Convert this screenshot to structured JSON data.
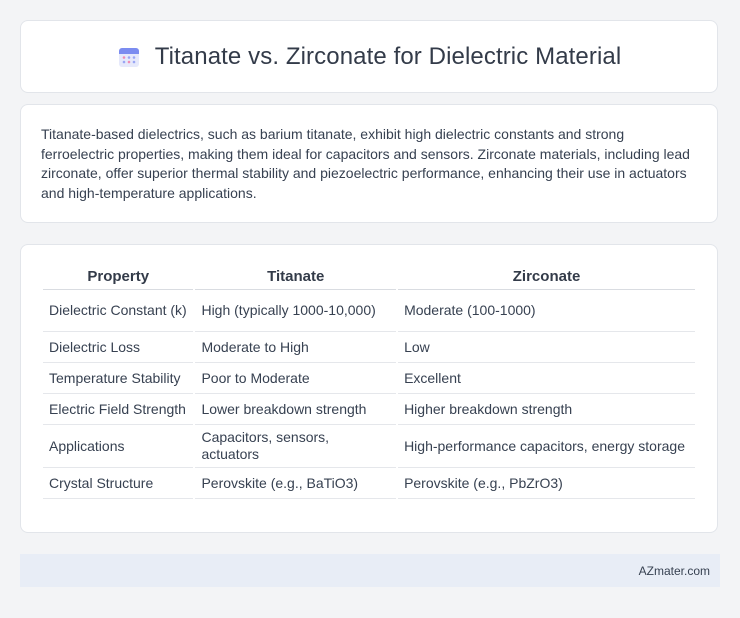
{
  "header": {
    "title": "Titanate vs. Zirconate for Dielectric Material",
    "icon": "calendar-icon"
  },
  "summary": {
    "text": "Titanate-based dielectrics, such as barium titanate, exhibit high dielectric constants and strong ferroelectric properties, making them ideal for capacitors and sensors. Zirconate materials, including lead zirconate, offer superior thermal stability and piezoelectric performance, enhancing their use in actuators and high-temperature applications."
  },
  "table": {
    "headers": [
      "Property",
      "Titanate",
      "Zirconate"
    ],
    "rows": [
      [
        "Dielectric Constant (k)",
        "High (typically 1000-10,000)",
        "Moderate (100-1000)"
      ],
      [
        "Dielectric Loss",
        "Moderate to High",
        "Low"
      ],
      [
        "Temperature Stability",
        "Poor to Moderate",
        "Excellent"
      ],
      [
        "Electric Field Strength",
        "Lower breakdown strength",
        "Higher breakdown strength"
      ],
      [
        "Applications",
        "Capacitors, sensors, actuators",
        "High-performance capacitors, energy storage"
      ],
      [
        "Crystal Structure",
        "Perovskite (e.g., BaTiO3)",
        "Perovskite (e.g., PbZrO3)"
      ]
    ]
  },
  "footer": {
    "site": "AZmater.com"
  }
}
